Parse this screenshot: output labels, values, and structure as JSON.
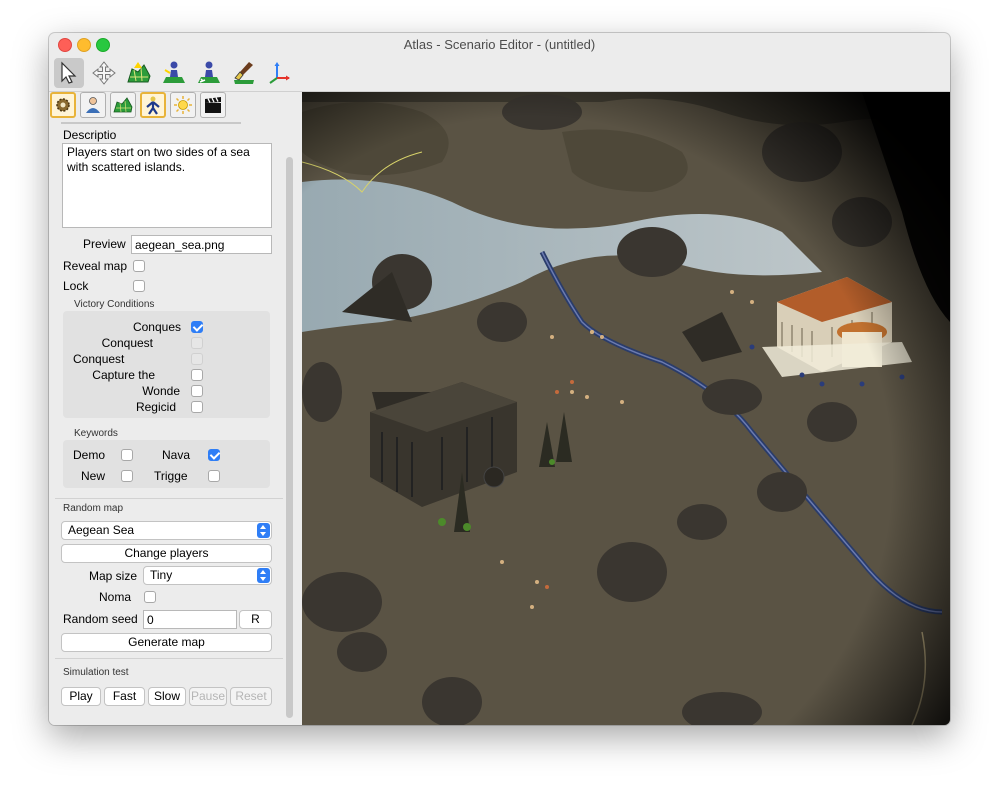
{
  "window": {
    "title": "Atlas - Scenario Editor - (untitled)"
  },
  "toolbar": {
    "tools": [
      "select-unit-tool",
      "transform-tool",
      "paint-terrain-tool",
      "place-object-tool",
      "replace-object-tool",
      "paint-texture-tool",
      "move-axis-tool"
    ]
  },
  "tabs": [
    "map-settings",
    "player",
    "terrain",
    "objects",
    "environment",
    "cinematics"
  ],
  "map": {
    "description_label": "Descriptio",
    "description": "Players start on two sides of a sea with scattered islands.",
    "preview_label": "Preview",
    "preview_value": "aegean_sea.png",
    "reveal_label": "Reveal map",
    "lock_label": "Lock",
    "victory_title": "Victory Conditions",
    "victory": [
      "Conques",
      "Conquest",
      "Conquest",
      "Capture the",
      "Wonde",
      "Regicid"
    ],
    "keywords_title": "Keywords",
    "keywords": [
      "Demo",
      "Nava",
      "New",
      "Trigge"
    ]
  },
  "random": {
    "title": "Random map",
    "selected": "Aegean Sea",
    "change_players": "Change players",
    "map_size_label": "Map size",
    "map_size": "Tiny",
    "nomad_label": "Noma",
    "seed_label": "Random seed",
    "seed_value": "0",
    "reseed_button": "R",
    "generate_button": "Generate map"
  },
  "sim": {
    "title": "Simulation test",
    "buttons": [
      "Play",
      "Fast",
      "Slow",
      "Pause",
      "Reset"
    ]
  },
  "colors": {
    "accent": "#2f7ef6",
    "tab_active": "#e8b339"
  }
}
